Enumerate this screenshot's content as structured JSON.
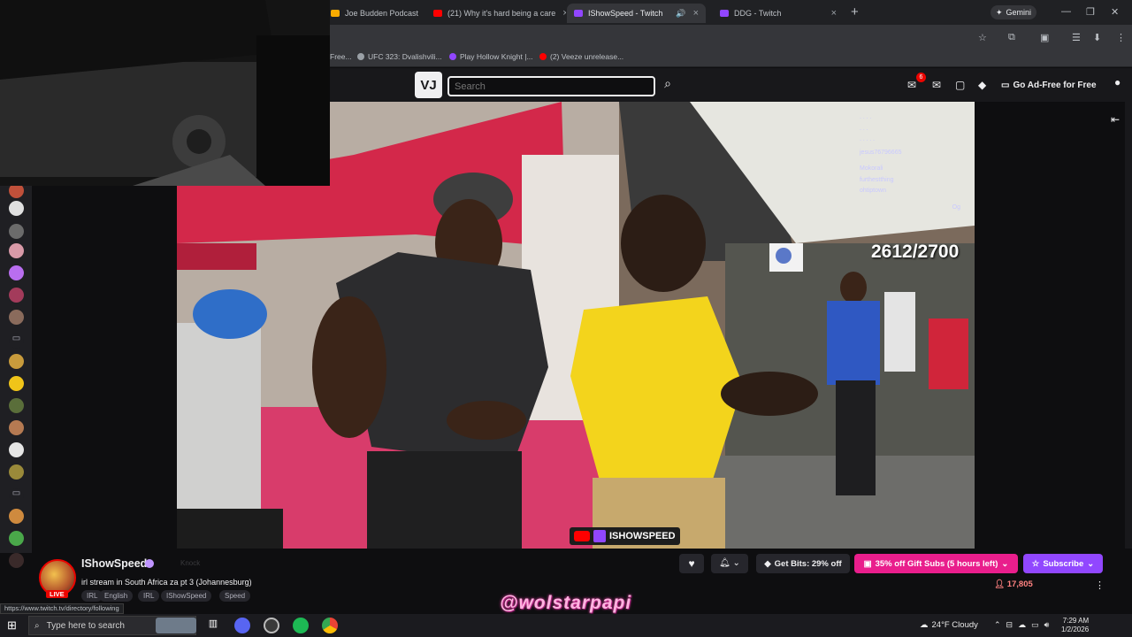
{
  "browser": {
    "tabs": [
      {
        "title": "Joe Budden Podcast E",
        "color": "#f9ab00"
      },
      {
        "title": "(21) Why it's hard being a care",
        "color": "#ff0000"
      },
      {
        "title": "IShowSpeed - Twitch",
        "color": "#9146ff",
        "active": true
      },
      {
        "title": "DDG - Twitch",
        "color": "#9146ff"
      }
    ],
    "new_tab": "+",
    "gemini_label": "Gemini",
    "bookmarks": [
      {
        "label": "Free...",
        "color": "#5f6368"
      },
      {
        "label": "UFC 323: Dvalishvili...",
        "color": "#5f6368"
      },
      {
        "label": "Play Hollow Knight |...",
        "color": "#9146ff"
      },
      {
        "label": "(2) Veeze unrelease...",
        "color": "#ff0000"
      }
    ]
  },
  "twitch": {
    "logo": "VJ",
    "search_placeholder": "Search",
    "notification_count": "6",
    "adfree_label": "Go Ad-Free for Free"
  },
  "video": {
    "counter": "2612/2700",
    "chat_lines": [
      "...",
      "jesus76796665",
      "Mokorali",
      "furthestthing",
      "ohtiptown",
      "Og"
    ],
    "badge_text": "ISHOWSPEED"
  },
  "channel": {
    "name": "IShowSpeed",
    "knock_label": "Knock",
    "live_label": "LIVE",
    "title": "irl stream in South Africa za pt 3 (Johannesburg)",
    "tags": [
      "IRL",
      "English",
      "IRL",
      "IShowSpeed",
      "Speed"
    ],
    "bits_label": "Get Bits: 29% off",
    "gift_label": "35% off Gift Subs (5 hours left)",
    "subscribe_label": "Subscribe",
    "viewers": "17,805"
  },
  "status_url": "https://www.twitch.tv/directory/following",
  "watermark": "@wolstarpapi",
  "taskbar": {
    "search_placeholder": "Type here to search",
    "weather": "24°F  Cloudy",
    "time": "7:29 AM",
    "date": "1/2/2026"
  },
  "colors": {
    "twitch_purple": "#9147ff",
    "live_red": "#eb0400",
    "gift_pink": "#e91e8c"
  }
}
